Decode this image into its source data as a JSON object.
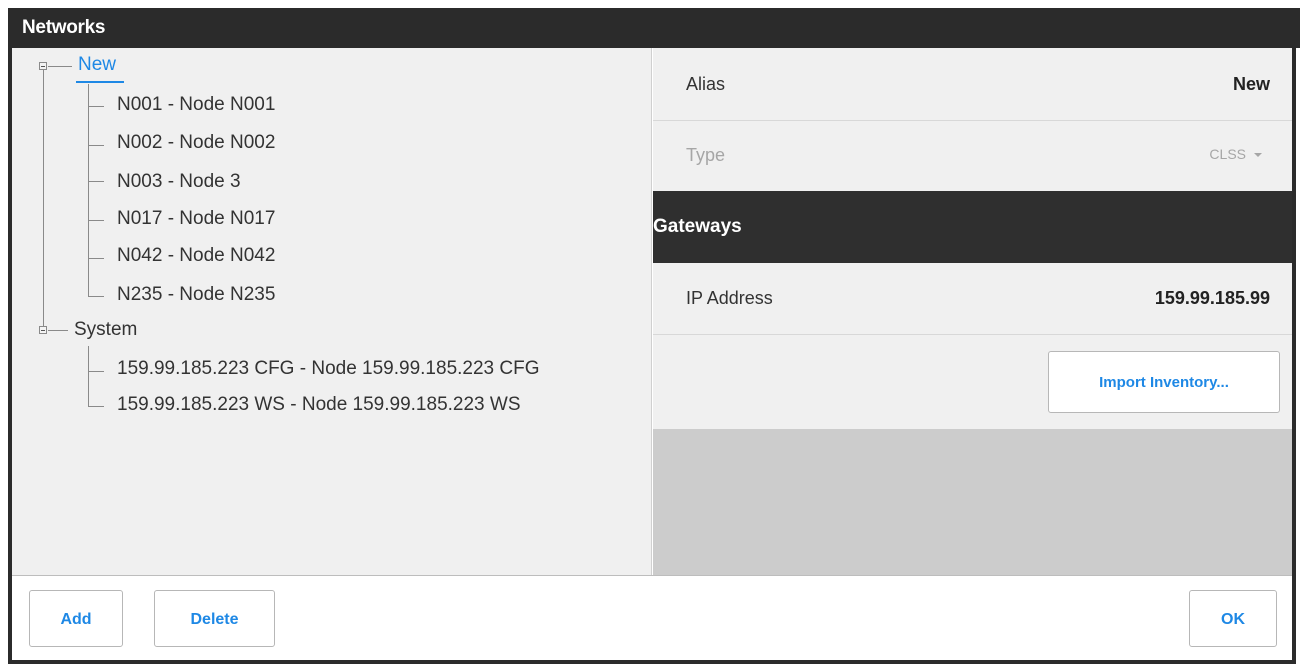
{
  "window": {
    "title": "Networks"
  },
  "tree": {
    "groups": [
      {
        "label": "New",
        "selected": true,
        "children": [
          "N001 - Node N001",
          "N002 - Node N002",
          "N003 - Node 3",
          "N017 - Node N017",
          "N042 - Node N042",
          "N235 - Node N235"
        ]
      },
      {
        "label": "System",
        "selected": false,
        "children": [
          "159.99.185.223 CFG - Node 159.99.185.223 CFG",
          "159.99.185.223 WS - Node 159.99.185.223 WS"
        ]
      }
    ]
  },
  "properties": {
    "alias_label": "Alias",
    "alias_value": "New",
    "type_label": "Type",
    "type_value": "CLSS"
  },
  "gateways": {
    "title": "Gateways",
    "ip_label": "IP Address",
    "ip_value": "159.99.185.99",
    "import_button": "Import Inventory..."
  },
  "footer": {
    "add_button": "Add",
    "delete_button": "Delete",
    "ok_button": "OK"
  },
  "colors": {
    "accent": "#1e88e5",
    "titlebar": "#2b2b2b",
    "pane_bg": "#f0f0f0",
    "empty_area": "#cccccc"
  }
}
